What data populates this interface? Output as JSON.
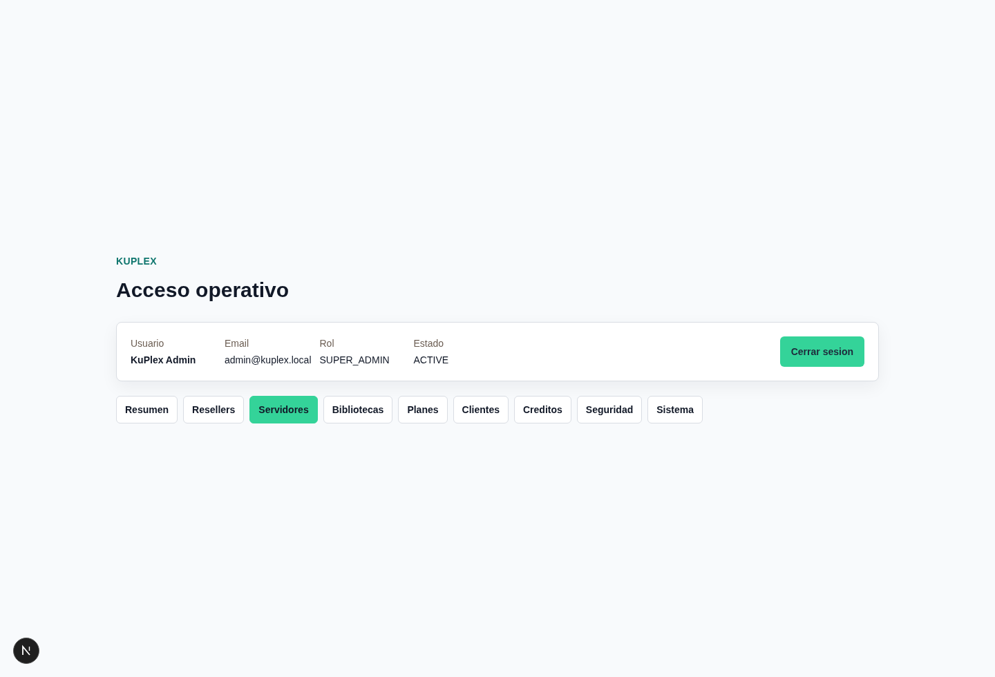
{
  "brand": "KUPLEX",
  "title": "Acceso operativo",
  "account": {
    "fields": [
      {
        "label": "Usuario",
        "value": "KuPlex Admin",
        "kind": "strong"
      },
      {
        "label": "Email",
        "value": "admin@kuplex.local",
        "kind": "plain"
      },
      {
        "label": "Rol",
        "value": "SUPER_ADMIN",
        "kind": "plain"
      },
      {
        "label": "Estado",
        "value": "ACTIVE",
        "kind": "plain"
      }
    ],
    "logout_button": "Cerrar sesion"
  },
  "tabs": [
    {
      "label": "Resumen",
      "selected": false
    },
    {
      "label": "Resellers",
      "selected": false
    },
    {
      "label": "Servidores",
      "selected": true
    },
    {
      "label": "Bibliotecas",
      "selected": false
    },
    {
      "label": "Planes",
      "selected": false
    },
    {
      "label": "Clientes",
      "selected": false
    },
    {
      "label": "Creditos",
      "selected": false
    },
    {
      "label": "Seguridad",
      "selected": false
    },
    {
      "label": "Sistema",
      "selected": false
    }
  ]
}
